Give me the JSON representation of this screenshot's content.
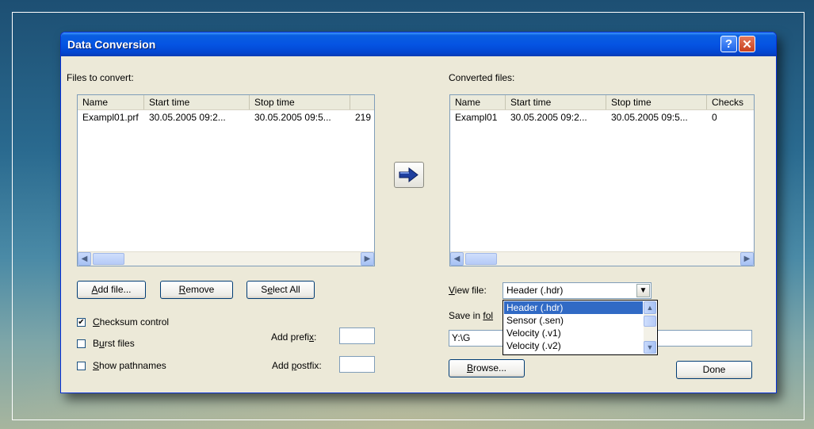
{
  "window": {
    "title": "Data Conversion",
    "help_glyph": "?",
    "close_glyph": "✕"
  },
  "left": {
    "section_label": "Files to convert:",
    "columns": [
      "Name",
      "Start time",
      "Stop time",
      ""
    ],
    "rows": [
      [
        "Exampl01.prf",
        "30.05.2005 09:2...",
        "30.05.2005 09:5...",
        "219"
      ]
    ],
    "scroll_left": "◀",
    "scroll_right": "▶",
    "buttons": {
      "add_file": {
        "prefix": "",
        "accel": "A",
        "rest": "dd file..."
      },
      "remove": {
        "prefix": "",
        "accel": "R",
        "rest": "emove"
      },
      "select_all": {
        "prefix": "S",
        "accel": "e",
        "rest": "lect All"
      }
    },
    "checks": [
      {
        "checked": true,
        "mark": "✔",
        "prefix": "",
        "accel": "C",
        "rest": "hecksum control"
      },
      {
        "checked": false,
        "mark": "",
        "prefix": "B",
        "accel": "u",
        "rest": "rst files"
      },
      {
        "checked": false,
        "mark": "",
        "prefix": "",
        "accel": "S",
        "rest": "how pathnames"
      }
    ],
    "prefix": {
      "prefix": "Add prefi",
      "accel": "x",
      "rest": ":",
      "value": ""
    },
    "postfix": {
      "prefix": "Add ",
      "accel": "p",
      "rest": "ostfix:",
      "value": ""
    }
  },
  "convert_icon": "arrow-right",
  "right": {
    "section_label": "Converted files:",
    "columns": [
      "Name",
      "Start time",
      "Stop time",
      "Checks"
    ],
    "rows": [
      [
        "Exampl01",
        "30.05.2005 09:2...",
        "30.05.2005 09:5...",
        "0"
      ]
    ],
    "scroll_left": "◀",
    "scroll_right": "▶",
    "view_file": {
      "prefix": "",
      "accel": "V",
      "rest": "iew file:",
      "value": "Header (.hdr)",
      "arrow": "▼"
    },
    "save_label": {
      "prefix": "Save in ",
      "accel": "fol",
      "rest": ""
    },
    "save_path": "Y:\\G",
    "browse": {
      "prefix": "",
      "accel": "B",
      "rest": "rowse..."
    },
    "done": "Done",
    "dropdown": {
      "options": [
        "Header (.hdr)",
        "Sensor (.sen)",
        "Velocity (.v1)",
        "Velocity (.v2)"
      ],
      "selected_index": 0,
      "up": "▲",
      "down": "▼"
    }
  }
}
